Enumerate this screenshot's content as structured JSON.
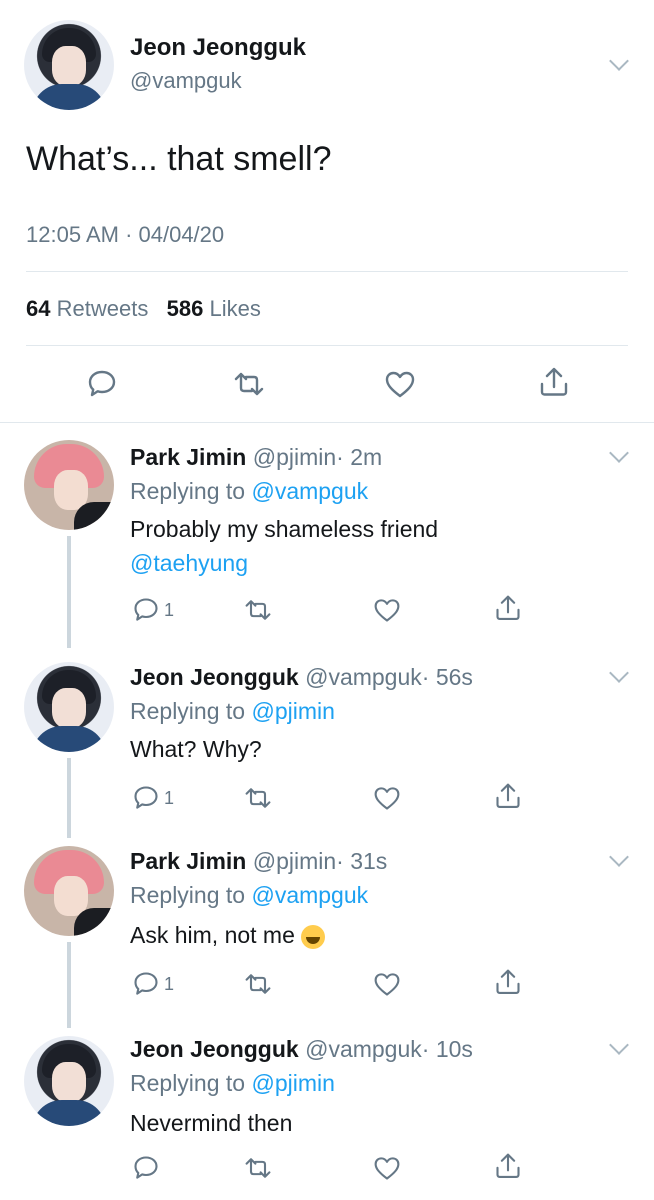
{
  "main_tweet": {
    "name": "Jeon Jeongguk",
    "handle": "@vampguk",
    "text": "What’s... that smell?",
    "timestamp": "12:05 AM · 04/04/20",
    "retweets_count": "64",
    "retweets_label": "Retweets",
    "likes_count": "586",
    "likes_label": "Likes"
  },
  "replies": [
    {
      "name": "Park Jimin",
      "handle": "@pjimin",
      "time": "· 2m",
      "replying_prefix": "Replying to",
      "replying_to": "@vampguk",
      "text": "Probably my shameless friend",
      "mention": "@taehyung",
      "reply_count": "1"
    },
    {
      "name": "Jeon Jeongguk",
      "handle": "@vampguk",
      "time": "· 56s",
      "replying_prefix": "Replying to",
      "replying_to": "@pjimin",
      "text": "What? Why?",
      "reply_count": "1"
    },
    {
      "name": "Park Jimin",
      "handle": "@pjimin",
      "time": "· 31s",
      "replying_prefix": "Replying to",
      "replying_to": "@vampguk",
      "text": "Ask him, not me",
      "emoji": "face-with-tears-of-joy-icon",
      "reply_count": "1"
    },
    {
      "name": "Jeon Jeongguk",
      "handle": "@vampguk",
      "time": "· 10s",
      "replying_prefix": "Replying to",
      "replying_to": "@pjimin",
      "text": "Nevermind then"
    }
  ],
  "colors": {
    "link": "#1da1f2",
    "secondary_text": "#657786",
    "divider": "#e1e8ed"
  }
}
